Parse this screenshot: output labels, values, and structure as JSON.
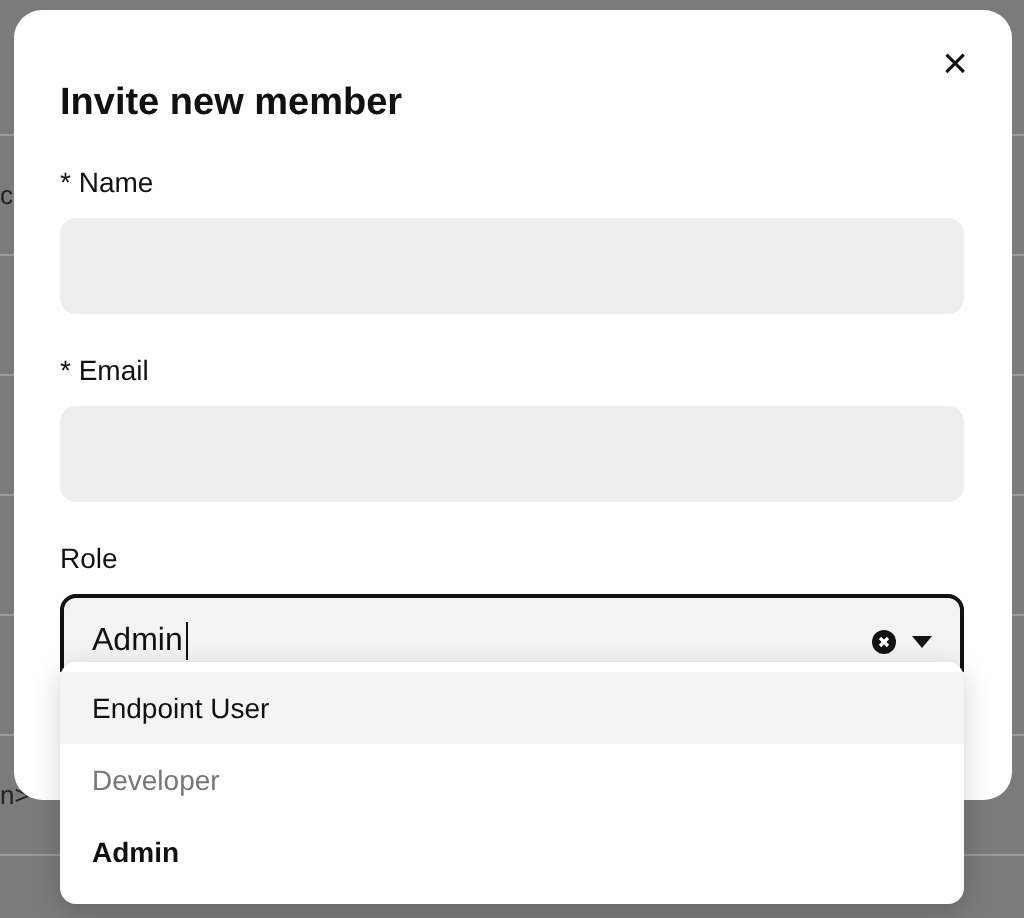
{
  "background_rows": [
    {},
    {
      "text": "c"
    },
    {},
    {},
    {},
    {},
    {
      "text": "n>"
    }
  ],
  "dialog": {
    "title": "Invite new member",
    "close": "×",
    "fields": [
      {
        "kind": "text",
        "label": "* Name"
      },
      {
        "kind": "text",
        "label": "* Email"
      },
      {
        "kind": "select",
        "label": "Role",
        "value": "Admin",
        "focused": true
      }
    ]
  },
  "dropdown": {
    "options": [
      {
        "label": "Endpoint User",
        "selected": false,
        "highlighted": true,
        "disabled": false
      },
      {
        "label": "Developer",
        "selected": false,
        "highlighted": false,
        "disabled": true
      },
      {
        "label": "Admin",
        "selected": true,
        "highlighted": false,
        "disabled": false
      }
    ]
  }
}
